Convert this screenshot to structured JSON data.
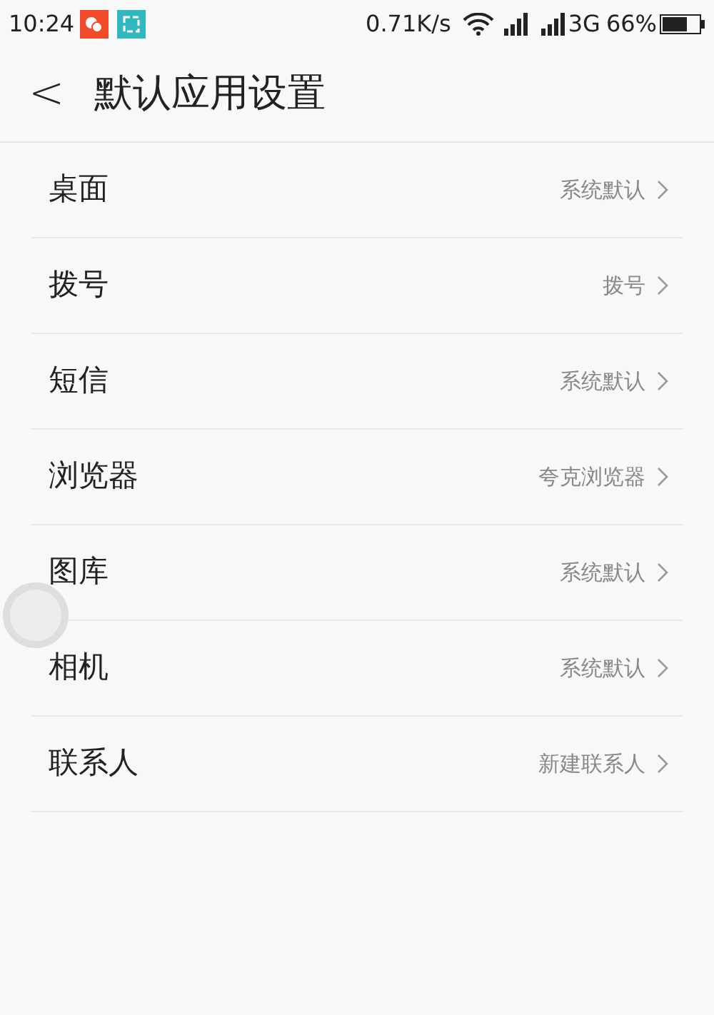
{
  "status_bar": {
    "time": "10:24",
    "speed": "0.71K/s",
    "network": "3G",
    "battery": "66%"
  },
  "header": {
    "back": "<",
    "title": "默认应用设置"
  },
  "items": [
    {
      "label": "桌面",
      "value": "系统默认"
    },
    {
      "label": "拨号",
      "value": "拨号"
    },
    {
      "label": "短信",
      "value": "系统默认"
    },
    {
      "label": "浏览器",
      "value": "夸克浏览器"
    },
    {
      "label": "图库",
      "value": "系统默认"
    },
    {
      "label": "相机",
      "value": "系统默认"
    },
    {
      "label": "联系人",
      "value": "新建联系人"
    }
  ]
}
